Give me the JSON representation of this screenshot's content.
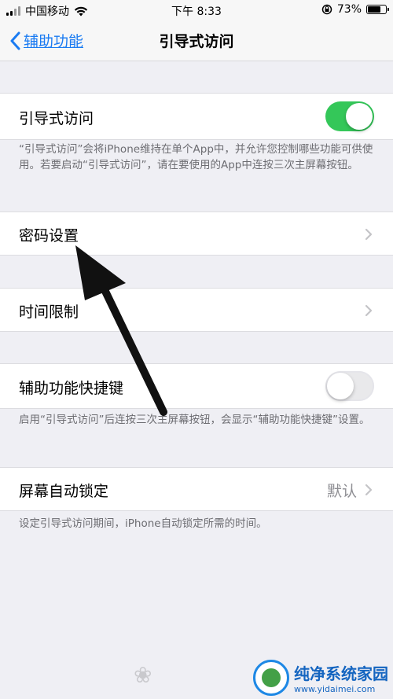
{
  "status_bar": {
    "carrier": "中国移动",
    "time": "下午 8:33",
    "battery_percent": "73%",
    "battery_level": 0.73
  },
  "nav": {
    "back_label": "辅助功能",
    "title": "引导式访问"
  },
  "sections": {
    "guided_access": {
      "label": "引导式访问",
      "switch_on": true,
      "footer": "“引导式访问”会将iPhone维持在单个App中，并允许您控制哪些功能可供使用。若要启动“引导式访问”，请在要使用的App中连按三次主屏幕按钮。"
    },
    "passcode": {
      "label": "密码设置"
    },
    "time_limits": {
      "label": "时间限制"
    },
    "accessibility_shortcut": {
      "label": "辅助功能快捷键",
      "switch_on": false,
      "footer": "启用“引导式访问”后连按三次主屏幕按钮，会显示“辅助功能快捷键”设置。"
    },
    "auto_lock": {
      "label": "屏幕自动锁定",
      "value": "默认",
      "footer": "设定引导式访问期间，iPhone自动锁定所需的时间。"
    }
  },
  "watermark": {
    "title": "纯净系统家园",
    "url": "www.yidaimei.com"
  },
  "colors": {
    "accent": "#1a7bf2",
    "switch_on": "#34c759",
    "background": "#efeff4"
  }
}
